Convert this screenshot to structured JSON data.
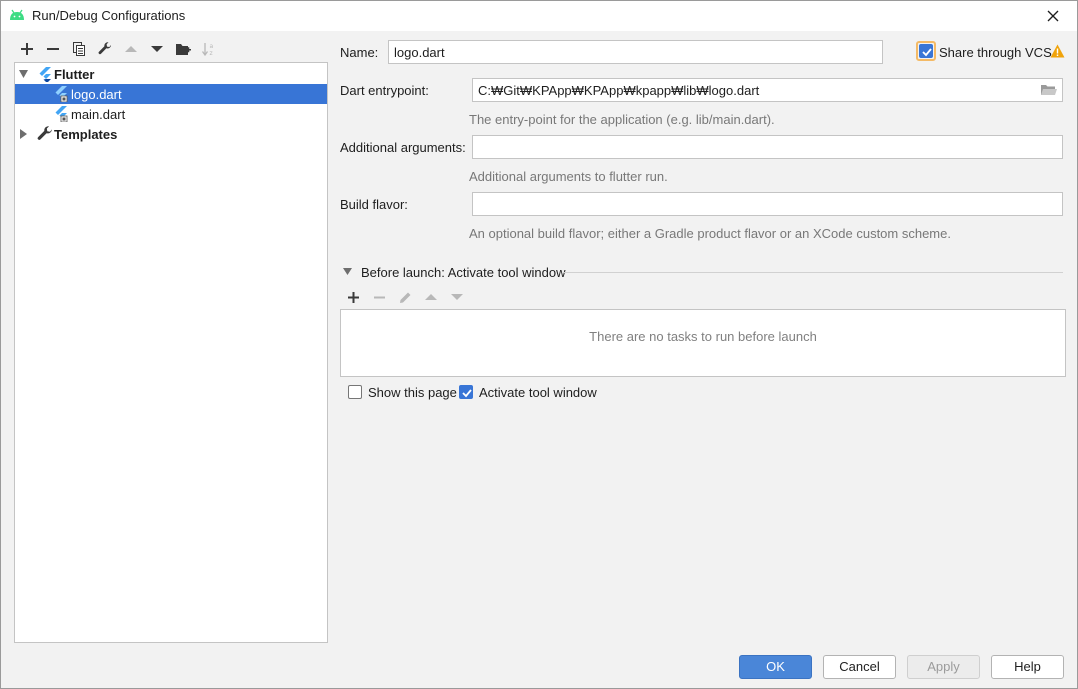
{
  "window": {
    "title": "Run/Debug Configurations",
    "close_icon": "close-x"
  },
  "toolbar": {
    "icons": [
      "plus-icon",
      "minus-icon",
      "copy-icon",
      "wrench-icon",
      "arrow-up-icon",
      "arrow-down-icon",
      "folder-new-icon",
      "sort-icon"
    ]
  },
  "tree": {
    "groups": [
      {
        "label": "Flutter",
        "expanded": true,
        "children": [
          {
            "label": "logo.dart",
            "selected": true
          },
          {
            "label": "main.dart",
            "selected": false
          }
        ]
      },
      {
        "label": "Templates",
        "expanded": false
      }
    ]
  },
  "form": {
    "name_label": "Name:",
    "name_value": "logo.dart",
    "share_vcs_label": "Share through VCS",
    "share_vcs_checked": true,
    "entrypoint_label": "Dart entrypoint:",
    "entrypoint_value": "C:₩Git₩KPApp₩KPApp₩kpapp₩lib₩logo.dart",
    "entrypoint_hint": "The entry-point for the application (e.g. lib/main.dart).",
    "args_label": "Additional arguments:",
    "args_value": "",
    "args_hint": "Additional arguments to flutter run.",
    "flavor_label": "Build flavor:",
    "flavor_value": "",
    "flavor_hint": "An optional build flavor; either a Gradle product flavor or an XCode custom scheme."
  },
  "before_launch": {
    "title": "Before launch: Activate tool window",
    "empty_text": "There are no tasks to run before launch",
    "show_page_label": "Show this page",
    "show_page_checked": false,
    "activate_label": "Activate tool window",
    "activate_checked": true
  },
  "buttons": {
    "ok": "OK",
    "cancel": "Cancel",
    "apply": "Apply",
    "help": "Help"
  },
  "colors": {
    "selection": "#3875d6",
    "primary_button": "#4a86d8",
    "warning": "#f0a30a",
    "flutter_blue": "#42a5f5"
  }
}
